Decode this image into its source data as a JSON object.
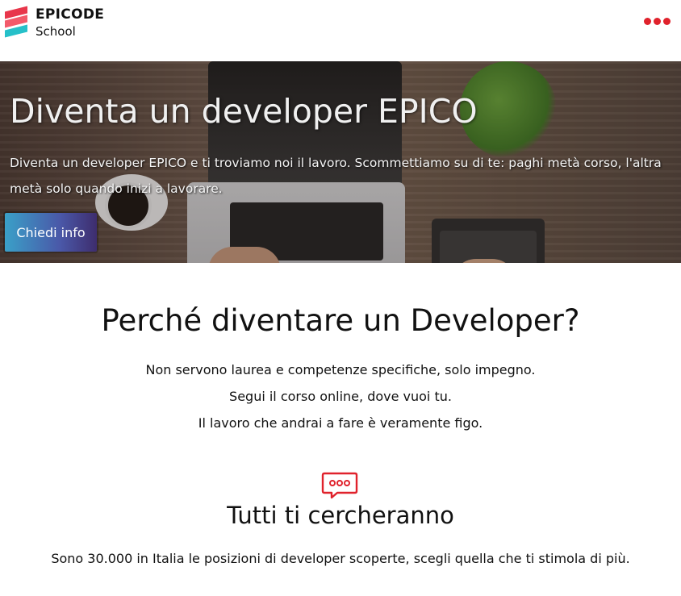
{
  "header": {
    "logo_line1": "EPICODE",
    "logo_line2": "School",
    "menu_icon": "more-dots-icon",
    "accent_color": "#e0222c"
  },
  "hero": {
    "title": "Diventa un developer EPICO",
    "subtitle": "Diventa un developer EPICO e ti troviamo noi il lavoro. Scommettiamo su di te: paghi metà corso, l'altra metà solo quando inizi a lavorare.",
    "cta_label": "Chiedi info"
  },
  "why": {
    "title": "Perché diventare un Developer?",
    "lines": [
      "Non servono laurea e competenze specifiche, solo impegno.",
      "Segui il corso online, dove vuoi tu.",
      "Il lavoro che andrai a fare è veramente figo."
    ]
  },
  "feature": {
    "icon": "chat-bubble-icon",
    "title": "Tutti ti cercheranno",
    "text": "Sono 30.000 in Italia le posizioni di developer scoperte, scegli quella che ti stimola di più."
  }
}
